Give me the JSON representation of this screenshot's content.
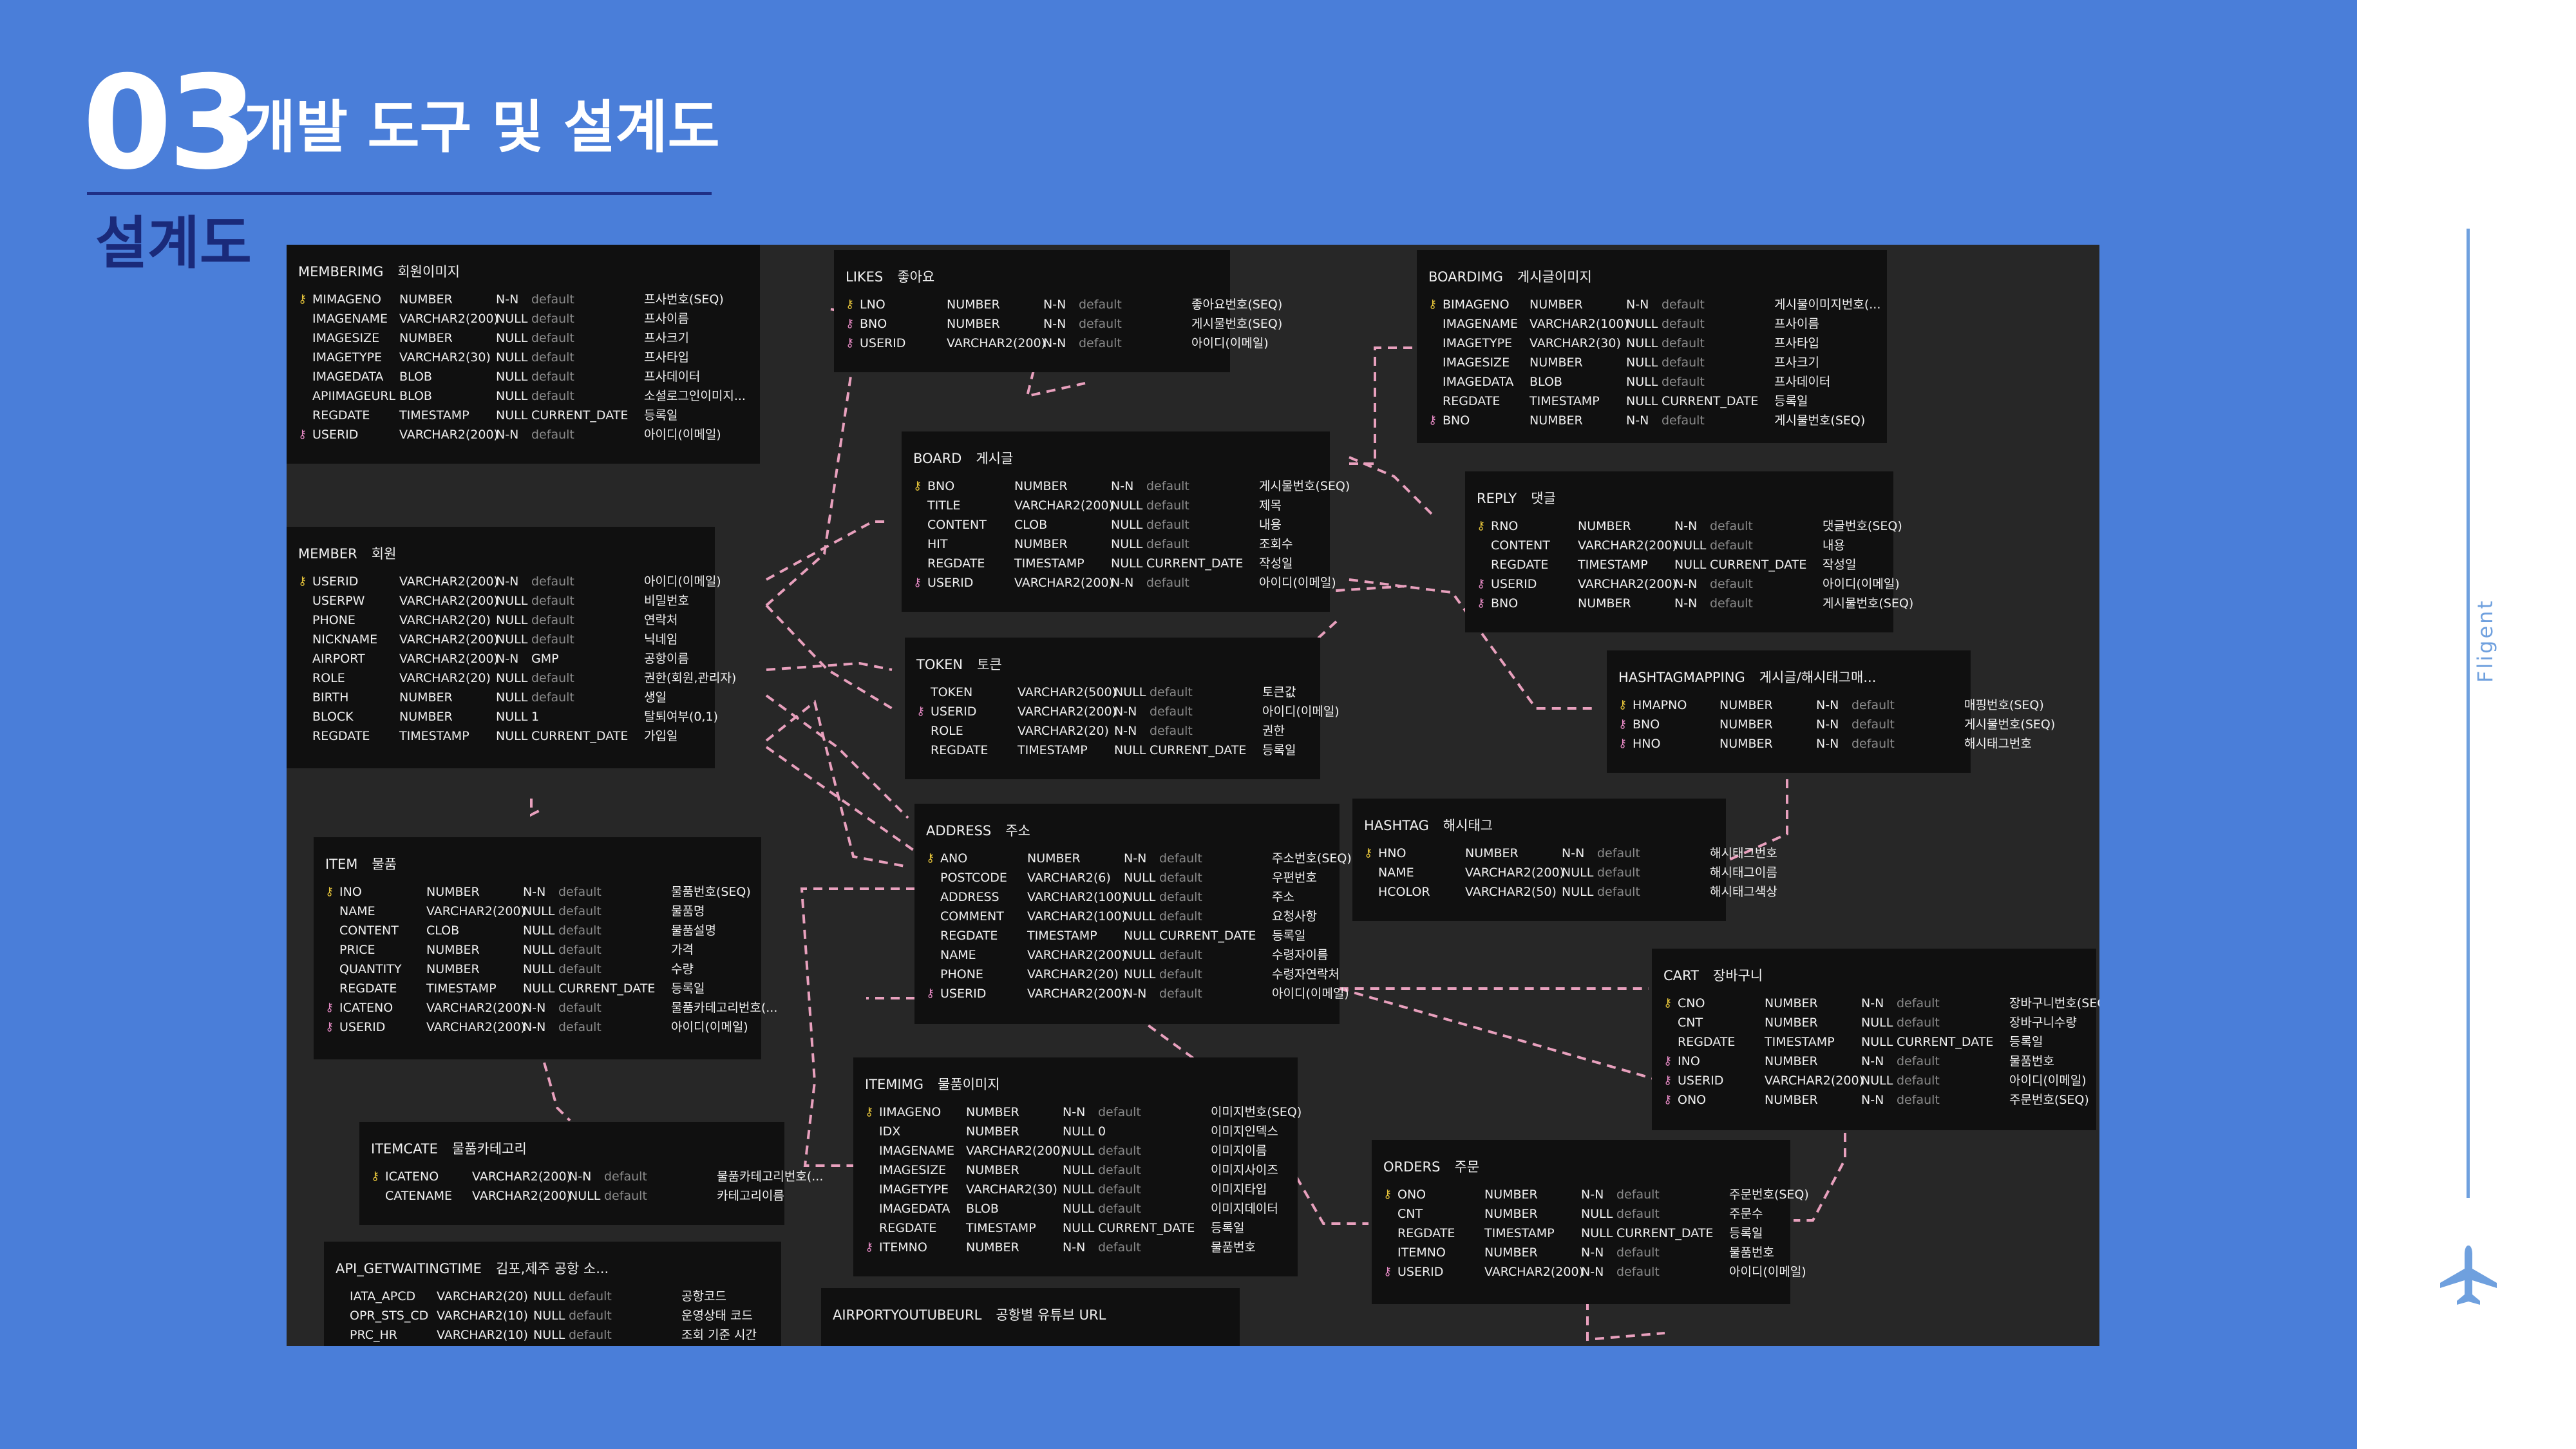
{
  "header": {
    "number": "03",
    "title": "개발 도구 및 설계도",
    "subtitle": "설계도"
  },
  "brand": "Fligent",
  "colors": {
    "background": "#4a7ed9",
    "diagram_bg": "#272727",
    "table_bg": "#101010",
    "link": "#e8a0bd",
    "pk_key": "#e6c43a",
    "fk_key": "#e88bc6"
  },
  "tables": {
    "memberimg": {
      "name": "MEMBERIMG",
      "comment": "회원이미지",
      "rows": [
        {
          "k": "pk",
          "n": "MIMAGENO",
          "t": "NUMBER",
          "nl": "N-N",
          "d": "default",
          "c": "프사번호(SEQ)"
        },
        {
          "k": "",
          "n": "IMAGENAME",
          "t": "VARCHAR2(200)",
          "nl": "NULL",
          "d": "default",
          "c": "프사이름"
        },
        {
          "k": "",
          "n": "IMAGESIZE",
          "t": "NUMBER",
          "nl": "NULL",
          "d": "default",
          "c": "프사크기"
        },
        {
          "k": "",
          "n": "IMAGETYPE",
          "t": "VARCHAR2(30)",
          "nl": "NULL",
          "d": "default",
          "c": "프사타입"
        },
        {
          "k": "",
          "n": "IMAGEDATA",
          "t": "BLOB",
          "nl": "NULL",
          "d": "default",
          "c": "프사데이터"
        },
        {
          "k": "",
          "n": "APIIMAGEURL",
          "t": "BLOB",
          "nl": "NULL",
          "d": "default",
          "c": "소셜로그인이미지..."
        },
        {
          "k": "",
          "n": "REGDATE",
          "t": "TIMESTAMP",
          "nl": "NULL",
          "d": "CURRENT_DATE",
          "c": "등록일"
        },
        {
          "k": "fk",
          "n": "USERID",
          "t": "VARCHAR2(200)",
          "nl": "N-N",
          "d": "default",
          "c": "아이디(이메일)"
        }
      ]
    },
    "likes": {
      "name": "LIKES",
      "comment": "좋아요",
      "rows": [
        {
          "k": "pk",
          "n": "LNO",
          "t": "NUMBER",
          "nl": "N-N",
          "d": "default",
          "c": "좋아요번호(SEQ)"
        },
        {
          "k": "fk",
          "n": "BNO",
          "t": "NUMBER",
          "nl": "N-N",
          "d": "default",
          "c": "게시물번호(SEQ)"
        },
        {
          "k": "fk",
          "n": "USERID",
          "t": "VARCHAR2(200)",
          "nl": "N-N",
          "d": "default",
          "c": "아이디(이메일)"
        }
      ]
    },
    "boardimg": {
      "name": "BOARDIMG",
      "comment": "게시글이미지",
      "rows": [
        {
          "k": "pk",
          "n": "BIMAGENO",
          "t": "NUMBER",
          "nl": "N-N",
          "d": "default",
          "c": "게시물이미지번호(..."
        },
        {
          "k": "",
          "n": "IMAGENAME",
          "t": "VARCHAR2(100)",
          "nl": "NULL",
          "d": "default",
          "c": "프사이름"
        },
        {
          "k": "",
          "n": "IMAGETYPE",
          "t": "VARCHAR2(30)",
          "nl": "NULL",
          "d": "default",
          "c": "프사타입"
        },
        {
          "k": "",
          "n": "IMAGESIZE",
          "t": "NUMBER",
          "nl": "NULL",
          "d": "default",
          "c": "프사크기"
        },
        {
          "k": "",
          "n": "IMAGEDATA",
          "t": "BLOB",
          "nl": "NULL",
          "d": "default",
          "c": "프사데이터"
        },
        {
          "k": "",
          "n": "REGDATE",
          "t": "TIMESTAMP",
          "nl": "NULL",
          "d": "CURRENT_DATE",
          "c": "등록일"
        },
        {
          "k": "fk",
          "n": "BNO",
          "t": "NUMBER",
          "nl": "N-N",
          "d": "default",
          "c": "게시물번호(SEQ)"
        }
      ]
    },
    "board": {
      "name": "BOARD",
      "comment": "게시글",
      "rows": [
        {
          "k": "pk",
          "n": "BNO",
          "t": "NUMBER",
          "nl": "N-N",
          "d": "default",
          "c": "게시물번호(SEQ)"
        },
        {
          "k": "",
          "n": "TITLE",
          "t": "VARCHAR2(200)",
          "nl": "NULL",
          "d": "default",
          "c": "제목"
        },
        {
          "k": "",
          "n": "CONTENT",
          "t": "CLOB",
          "nl": "NULL",
          "d": "default",
          "c": "내용"
        },
        {
          "k": "",
          "n": "HIT",
          "t": "NUMBER",
          "nl": "NULL",
          "d": "default",
          "c": "조회수"
        },
        {
          "k": "",
          "n": "REGDATE",
          "t": "TIMESTAMP",
          "nl": "NULL",
          "d": "CURRENT_DATE",
          "c": "작성일"
        },
        {
          "k": "fk",
          "n": "USERID",
          "t": "VARCHAR2(200)",
          "nl": "N-N",
          "d": "default",
          "c": "아이디(이메일)"
        }
      ]
    },
    "reply": {
      "name": "REPLY",
      "comment": "댓글",
      "rows": [
        {
          "k": "pk",
          "n": "RNO",
          "t": "NUMBER",
          "nl": "N-N",
          "d": "default",
          "c": "댓글번호(SEQ)"
        },
        {
          "k": "",
          "n": "CONTENT",
          "t": "VARCHAR2(200)",
          "nl": "NULL",
          "d": "default",
          "c": "내용"
        },
        {
          "k": "",
          "n": "REGDATE",
          "t": "TIMESTAMP",
          "nl": "NULL",
          "d": "CURRENT_DATE",
          "c": "작성일"
        },
        {
          "k": "fk",
          "n": "USERID",
          "t": "VARCHAR2(200)",
          "nl": "N-N",
          "d": "default",
          "c": "아이디(이메일)"
        },
        {
          "k": "fk",
          "n": "BNO",
          "t": "NUMBER",
          "nl": "N-N",
          "d": "default",
          "c": "게시물번호(SEQ)"
        }
      ]
    },
    "member": {
      "name": "MEMBER",
      "comment": "회원",
      "rows": [
        {
          "k": "pk",
          "n": "USERID",
          "t": "VARCHAR2(200)",
          "nl": "N-N",
          "d": "default",
          "c": "아이디(이메일)"
        },
        {
          "k": "",
          "n": "USERPW",
          "t": "VARCHAR2(200)",
          "nl": "NULL",
          "d": "default",
          "c": "비밀번호"
        },
        {
          "k": "",
          "n": "PHONE",
          "t": "VARCHAR2(20)",
          "nl": "NULL",
          "d": "default",
          "c": "연락처"
        },
        {
          "k": "",
          "n": "NICKNAME",
          "t": "VARCHAR2(200)",
          "nl": "NULL",
          "d": "default",
          "c": "닉네임"
        },
        {
          "k": "",
          "n": "AIRPORT",
          "t": "VARCHAR2(200)",
          "nl": "N-N",
          "d": "GMP",
          "c": "공항이름"
        },
        {
          "k": "",
          "n": "ROLE",
          "t": "VARCHAR2(20)",
          "nl": "NULL",
          "d": "default",
          "c": "권한(회원,관리자)"
        },
        {
          "k": "",
          "n": "BIRTH",
          "t": "NUMBER",
          "nl": "NULL",
          "d": "default",
          "c": "생일"
        },
        {
          "k": "",
          "n": "BLOCK",
          "t": "NUMBER",
          "nl": "NULL",
          "d": "1",
          "c": "탈퇴여부(0,1)"
        },
        {
          "k": "",
          "n": "REGDATE",
          "t": "TIMESTAMP",
          "nl": "NULL",
          "d": "CURRENT_DATE",
          "c": "가입일"
        }
      ]
    },
    "token": {
      "name": "TOKEN",
      "comment": "토큰",
      "rows": [
        {
          "k": "",
          "n": "TOKEN",
          "t": "VARCHAR2(500)",
          "nl": "NULL",
          "d": "default",
          "c": "토큰값"
        },
        {
          "k": "fk",
          "n": "USERID",
          "t": "VARCHAR2(200)",
          "nl": "N-N",
          "d": "default",
          "c": "아이디(이메일)"
        },
        {
          "k": "",
          "n": "ROLE",
          "t": "VARCHAR2(20)",
          "nl": "N-N",
          "d": "default",
          "c": "권한"
        },
        {
          "k": "",
          "n": "REGDATE",
          "t": "TIMESTAMP",
          "nl": "NULL",
          "d": "CURRENT_DATE",
          "c": "등록일"
        }
      ]
    },
    "hashtagmapping": {
      "name": "HASHTAGMAPPING",
      "comment": "게시글/해시태그매...",
      "rows": [
        {
          "k": "pk",
          "n": "HMAPNO",
          "t": "NUMBER",
          "nl": "N-N",
          "d": "default",
          "c": "매핑번호(SEQ)"
        },
        {
          "k": "fk",
          "n": "BNO",
          "t": "NUMBER",
          "nl": "N-N",
          "d": "default",
          "c": "게시물번호(SEQ)"
        },
        {
          "k": "fk",
          "n": "HNO",
          "t": "NUMBER",
          "nl": "N-N",
          "d": "default",
          "c": "해시태그번호"
        }
      ]
    },
    "address": {
      "name": "ADDRESS",
      "comment": "주소",
      "rows": [
        {
          "k": "pk",
          "n": "ANO",
          "t": "NUMBER",
          "nl": "N-N",
          "d": "default",
          "c": "주소번호(SEQ)"
        },
        {
          "k": "",
          "n": "POSTCODE",
          "t": "VARCHAR2(6)",
          "nl": "NULL",
          "d": "default",
          "c": "우편번호"
        },
        {
          "k": "",
          "n": "ADDRESS",
          "t": "VARCHAR2(100)",
          "nl": "NULL",
          "d": "default",
          "c": "주소"
        },
        {
          "k": "",
          "n": "COMMENT",
          "t": "VARCHAR2(100)",
          "nl": "NULL",
          "d": "default",
          "c": "요청사항"
        },
        {
          "k": "",
          "n": "REGDATE",
          "t": "TIMESTAMP",
          "nl": "NULL",
          "d": "CURRENT_DATE",
          "c": "등록일"
        },
        {
          "k": "",
          "n": "NAME",
          "t": "VARCHAR2(200)",
          "nl": "NULL",
          "d": "default",
          "c": "수령자이름"
        },
        {
          "k": "",
          "n": "PHONE",
          "t": "VARCHAR2(20)",
          "nl": "NULL",
          "d": "default",
          "c": "수령자연락처"
        },
        {
          "k": "fk",
          "n": "USERID",
          "t": "VARCHAR2(200)",
          "nl": "N-N",
          "d": "default",
          "c": "아이디(이메일)"
        }
      ]
    },
    "hashtag": {
      "name": "HASHTAG",
      "comment": "해시태그",
      "rows": [
        {
          "k": "pk",
          "n": "HNO",
          "t": "NUMBER",
          "nl": "N-N",
          "d": "default",
          "c": "해시태그번호"
        },
        {
          "k": "",
          "n": "NAME",
          "t": "VARCHAR2(200)",
          "nl": "NULL",
          "d": "default",
          "c": "해시태그이름"
        },
        {
          "k": "",
          "n": "HCOLOR",
          "t": "VARCHAR2(50)",
          "nl": "NULL",
          "d": "default",
          "c": "해시태그색상"
        }
      ]
    },
    "item": {
      "name": "ITEM",
      "comment": "물품",
      "rows": [
        {
          "k": "pk",
          "n": "INO",
          "t": "NUMBER",
          "nl": "N-N",
          "d": "default",
          "c": "물품번호(SEQ)"
        },
        {
          "k": "",
          "n": "NAME",
          "t": "VARCHAR2(200)",
          "nl": "NULL",
          "d": "default",
          "c": "물품명"
        },
        {
          "k": "",
          "n": "CONTENT",
          "t": "CLOB",
          "nl": "NULL",
          "d": "default",
          "c": "물품설명"
        },
        {
          "k": "",
          "n": "PRICE",
          "t": "NUMBER",
          "nl": "NULL",
          "d": "default",
          "c": "가격"
        },
        {
          "k": "",
          "n": "QUANTITY",
          "t": "NUMBER",
          "nl": "NULL",
          "d": "default",
          "c": "수량"
        },
        {
          "k": "",
          "n": "REGDATE",
          "t": "TIMESTAMP",
          "nl": "NULL",
          "d": "CURRENT_DATE",
          "c": "등록일"
        },
        {
          "k": "fk",
          "n": "ICATENO",
          "t": "VARCHAR2(200)",
          "nl": "N-N",
          "d": "default",
          "c": "물품카테고리번호(..."
        },
        {
          "k": "fk",
          "n": "USERID",
          "t": "VARCHAR2(200)",
          "nl": "N-N",
          "d": "default",
          "c": "아이디(이메일)"
        }
      ]
    },
    "cart": {
      "name": "CART",
      "comment": "장바구니",
      "rows": [
        {
          "k": "pk",
          "n": "CNO",
          "t": "NUMBER",
          "nl": "N-N",
          "d": "default",
          "c": "장바구니번호(SEQ)"
        },
        {
          "k": "",
          "n": "CNT",
          "t": "NUMBER",
          "nl": "NULL",
          "d": "default",
          "c": "장바구니수량"
        },
        {
          "k": "",
          "n": "REGDATE",
          "t": "TIMESTAMP",
          "nl": "NULL",
          "d": "CURRENT_DATE",
          "c": "등록일"
        },
        {
          "k": "fk",
          "n": "INO",
          "t": "NUMBER",
          "nl": "N-N",
          "d": "default",
          "c": "물품번호"
        },
        {
          "k": "fk",
          "n": "USERID",
          "t": "VARCHAR2(200)",
          "nl": "NULL",
          "d": "default",
          "c": "아이디(이메일)"
        },
        {
          "k": "fk",
          "n": "ONO",
          "t": "NUMBER",
          "nl": "N-N",
          "d": "default",
          "c": "주문번호(SEQ)"
        }
      ]
    },
    "itemcate": {
      "name": "ITEMCATE",
      "comment": "물품카테고리",
      "rows": [
        {
          "k": "pk",
          "n": "ICATENO",
          "t": "VARCHAR2(200)",
          "nl": "N-N",
          "d": "default",
          "c": "물품카테고리번호(..."
        },
        {
          "k": "",
          "n": "CATENAME",
          "t": "VARCHAR2(200)",
          "nl": "NULL",
          "d": "default",
          "c": "카테고리이름"
        }
      ]
    },
    "itemimg": {
      "name": "ITEMIMG",
      "comment": "물품이미지",
      "rows": [
        {
          "k": "pk",
          "n": "IIMAGENO",
          "t": "NUMBER",
          "nl": "N-N",
          "d": "default",
          "c": "이미지번호(SEQ)"
        },
        {
          "k": "",
          "n": "IDX",
          "t": "NUMBER",
          "nl": "NULL",
          "d": "0",
          "c": "이미지인덱스"
        },
        {
          "k": "",
          "n": "IMAGENAME",
          "t": "VARCHAR2(200)",
          "nl": "NULL",
          "d": "default",
          "c": "이미지이름"
        },
        {
          "k": "",
          "n": "IMAGESIZE",
          "t": "NUMBER",
          "nl": "NULL",
          "d": "default",
          "c": "이미지사이즈"
        },
        {
          "k": "",
          "n": "IMAGETYPE",
          "t": "VARCHAR2(30)",
          "nl": "NULL",
          "d": "default",
          "c": "이미지타입"
        },
        {
          "k": "",
          "n": "IMAGEDATA",
          "t": "BLOB",
          "nl": "NULL",
          "d": "default",
          "c": "이미지데이터"
        },
        {
          "k": "",
          "n": "REGDATE",
          "t": "TIMESTAMP",
          "nl": "NULL",
          "d": "CURRENT_DATE",
          "c": "등록일"
        },
        {
          "k": "fk",
          "n": "ITEMNO",
          "t": "NUMBER",
          "nl": "N-N",
          "d": "default",
          "c": "물품번호"
        }
      ]
    },
    "orders": {
      "name": "ORDERS",
      "comment": "주문",
      "rows": [
        {
          "k": "pk",
          "n": "ONO",
          "t": "NUMBER",
          "nl": "N-N",
          "d": "default",
          "c": "주문번호(SEQ)"
        },
        {
          "k": "",
          "n": "CNT",
          "t": "NUMBER",
          "nl": "NULL",
          "d": "default",
          "c": "주문수"
        },
        {
          "k": "",
          "n": "REGDATE",
          "t": "TIMESTAMP",
          "nl": "NULL",
          "d": "CURRENT_DATE",
          "c": "등록일"
        },
        {
          "k": "",
          "n": "ITEMNO",
          "t": "NUMBER",
          "nl": "N-N",
          "d": "default",
          "c": "물품번호"
        },
        {
          "k": "fk",
          "n": "USERID",
          "t": "VARCHAR2(200)",
          "nl": "N-N",
          "d": "default",
          "c": "아이디(이메일)"
        }
      ]
    },
    "api_getwaitingtime": {
      "name": "API_GETWAITINGTIME",
      "comment": "김포,제주 공항 소...",
      "rows": [
        {
          "k": "",
          "n": "IATA_APCD",
          "t": "VARCHAR2(20)",
          "nl": "NULL",
          "d": "default",
          "c": "공항코드"
        },
        {
          "k": "",
          "n": "OPR_STS_CD",
          "t": "VARCHAR2(10)",
          "nl": "NULL",
          "d": "default",
          "c": "운영상태 코드"
        },
        {
          "k": "",
          "n": "PRC_HR",
          "t": "VARCHAR2(10)",
          "nl": "NULL",
          "d": "default",
          "c": "조회 기준 시간"
        }
      ]
    },
    "airportyoutubeurl": {
      "name": "AIRPORTYOUTUBEURL",
      "comment": "공항별 유튜브 URL",
      "rows": []
    }
  }
}
